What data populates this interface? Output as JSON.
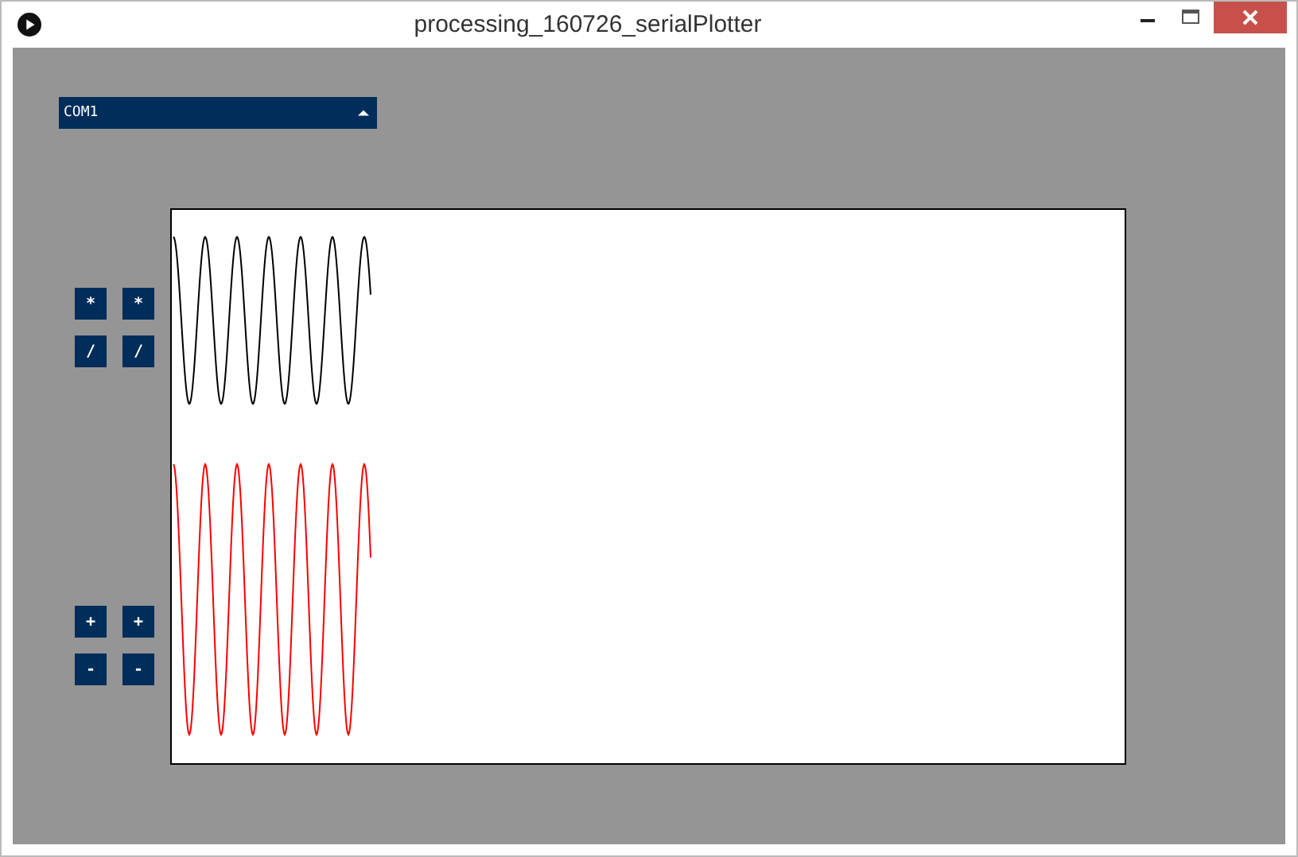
{
  "window": {
    "title": "processing_160726_serialPlotter"
  },
  "port_dropdown": {
    "value": "COM1"
  },
  "button_groups": [
    {
      "rows": [
        [
          "*",
          "*"
        ],
        [
          "/",
          "/"
        ]
      ]
    },
    {
      "rows": [
        [
          "+",
          "+"
        ],
        [
          "-",
          "-"
        ]
      ]
    }
  ]
}
